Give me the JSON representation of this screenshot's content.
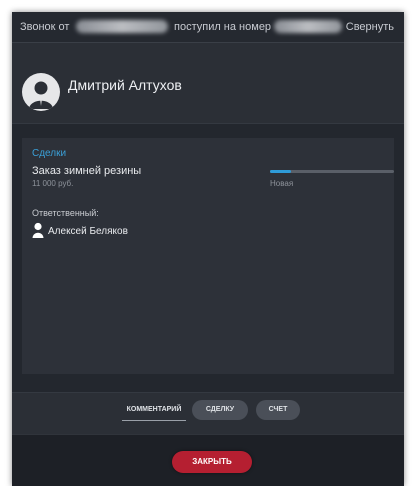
{
  "topbar": {
    "prefix": "Звонок от",
    "middle": "поступил на номер",
    "collapse_label": "Свернуть"
  },
  "contact": {
    "name": "Дмитрий Алтухов"
  },
  "deals": {
    "section_title": "Сделки",
    "items": [
      {
        "title": "Заказ зимней резины",
        "price": "11 000 руб.",
        "stage": "Новая",
        "progress": 0.17
      }
    ],
    "responsible_label": "Ответственный:",
    "responsible_name": "Алексей Беляков"
  },
  "tabs": {
    "comment": "КОММЕНТАРИЙ",
    "deal": "СДЕЛКУ",
    "invoice": "СЧЕТ"
  },
  "footer": {
    "close_label": "ЗАКРЫТЬ"
  },
  "colors": {
    "accent": "#2e9bd8",
    "close_button": "#b51f31",
    "background": "#2b2f36"
  },
  "icons": {
    "contact_avatar": "person-icon",
    "responsible": "person-icon"
  }
}
